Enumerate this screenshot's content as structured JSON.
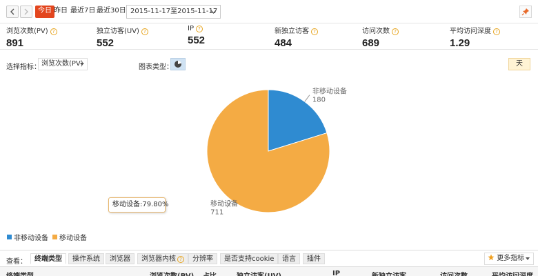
{
  "toolbar": {
    "ranges": [
      "今日",
      "昨日",
      "最近7日",
      "最近30日"
    ],
    "active_range": 0,
    "date_range": "2015-11-17至2015-11-17"
  },
  "metrics": [
    {
      "label": "浏览次数(PV)",
      "value": "891"
    },
    {
      "label": "独立访客(UV)",
      "value": "552"
    },
    {
      "label": "IP",
      "value": "552"
    },
    {
      "label": "新独立访客",
      "value": "484"
    },
    {
      "label": "访问次数",
      "value": "689"
    },
    {
      "label": "平均访问深度",
      "value": "1.29"
    }
  ],
  "selectors": {
    "metric_label": "选择指标：",
    "metric_value": "浏览次数(PV)",
    "chart_type_label": "图表类型：",
    "day_button": "天"
  },
  "chart_data": {
    "type": "pie",
    "categories": [
      "非移动设备",
      "移动设备"
    ],
    "values": [
      180,
      711
    ],
    "colors": [
      "#2f8bd1",
      "#f4ab44"
    ],
    "tooltip": "移动设备:79.80%",
    "legend": [
      "非移动设备",
      "移动设备"
    ]
  },
  "tabs": {
    "label": "查看：",
    "items": [
      "终端类型",
      "操作系统",
      "浏览器",
      "浏览器内核",
      "分辨率",
      "是否支持cookie",
      "语言",
      "插件"
    ],
    "active": 0,
    "more": "更多指标"
  },
  "table": {
    "headers": [
      "终端类型",
      "浏览次数(PV)",
      "占比",
      "独立访客(UV)",
      "IP",
      "新独立访客",
      "访问次数",
      "平均访问深度"
    ]
  }
}
